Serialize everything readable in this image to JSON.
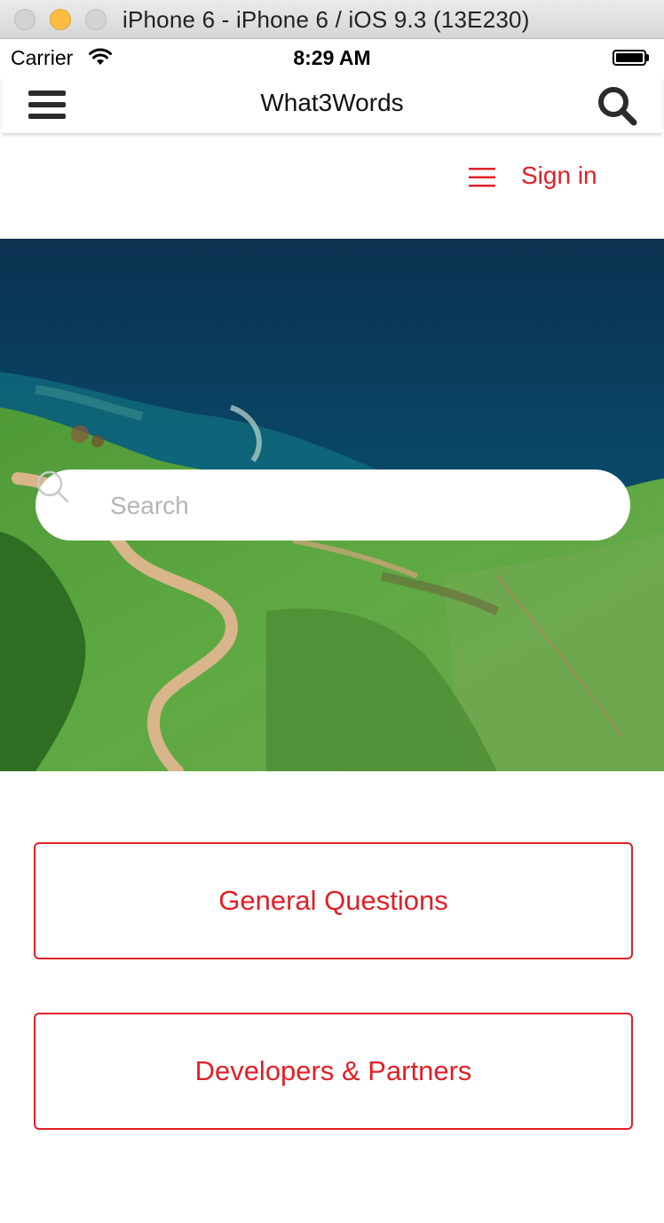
{
  "window": {
    "title": "iPhone 6 - iPhone 6 / iOS 9.3 (13E230)"
  },
  "status_bar": {
    "carrier": "Carrier",
    "time": "8:29 AM"
  },
  "nav_bar": {
    "title": "What3Words",
    "left_icon": "hamburger-menu-icon",
    "right_icon": "search-icon"
  },
  "page_header": {
    "menu_icon": "hamburger-menu-icon",
    "sign_in_label": "Sign in"
  },
  "hero": {
    "search_placeholder": "Search"
  },
  "buttons": {
    "general_questions": "General Questions",
    "developers_partners": "Developers & Partners"
  },
  "colors": {
    "accent": "#e11f26",
    "sea": "#0a3f5e",
    "grass": "#5a9e3a"
  }
}
